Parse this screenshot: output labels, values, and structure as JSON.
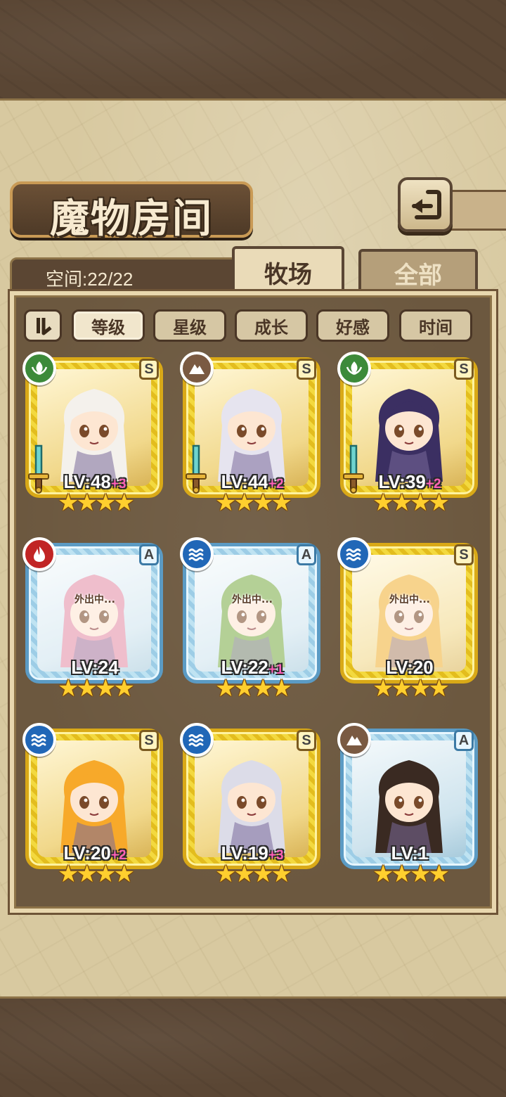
{
  "title": "魔物房间",
  "space": {
    "label": "空间:22/22"
  },
  "tabs": [
    {
      "label": "牧场",
      "active": true
    },
    {
      "label": "全部",
      "active": false
    }
  ],
  "sort": [
    {
      "label": "等级",
      "active": true
    },
    {
      "label": "星级",
      "active": false
    },
    {
      "label": "成长",
      "active": false
    },
    {
      "label": "好感",
      "active": false
    },
    {
      "label": "时间",
      "active": false
    }
  ],
  "away_label": "外出中...",
  "monsters": [
    {
      "level": "LV:48",
      "plus": "+3",
      "stars": 4,
      "rank": "S",
      "element": "nature-icon",
      "frame": "gold",
      "away": false,
      "weapon": true,
      "hair": "#f4f1ec"
    },
    {
      "level": "LV:44",
      "plus": "+2",
      "stars": 4,
      "rank": "S",
      "element": "earth-icon",
      "frame": "gold",
      "away": false,
      "weapon": true,
      "hair": "#e6e4ef"
    },
    {
      "level": "LV:39",
      "plus": "+2",
      "stars": 4,
      "rank": "S",
      "element": "nature-icon",
      "frame": "gold",
      "away": false,
      "weapon": true,
      "hair": "#3b2f62"
    },
    {
      "level": "LV:24",
      "plus": "",
      "stars": 4,
      "rank": "A",
      "element": "fire-icon",
      "frame": "blue",
      "away": true,
      "weapon": false,
      "hair": "#e48fa8"
    },
    {
      "level": "LV:22",
      "plus": "+1",
      "stars": 4,
      "rank": "A",
      "element": "water-icon",
      "frame": "blue",
      "away": true,
      "weapon": false,
      "hair": "#7fae4a"
    },
    {
      "level": "LV:20",
      "plus": "",
      "stars": 4,
      "rank": "S",
      "element": "water-icon",
      "frame": "gold",
      "away": true,
      "weapon": false,
      "hair": "#f2b43a"
    },
    {
      "level": "LV:20",
      "plus": "+2",
      "stars": 4,
      "rank": "S",
      "element": "water-icon",
      "frame": "gold",
      "away": false,
      "weapon": false,
      "hair": "#f7a92a"
    },
    {
      "level": "LV:19",
      "plus": "+3",
      "stars": 4,
      "rank": "S",
      "element": "water-icon",
      "frame": "gold",
      "away": false,
      "weapon": false,
      "hair": "#dcdce8"
    },
    {
      "level": "LV:1",
      "plus": "",
      "stars": 4,
      "rank": "A",
      "element": "earth-icon",
      "frame": "blue",
      "away": false,
      "weapon": false,
      "hair": "#3a2a22"
    }
  ]
}
